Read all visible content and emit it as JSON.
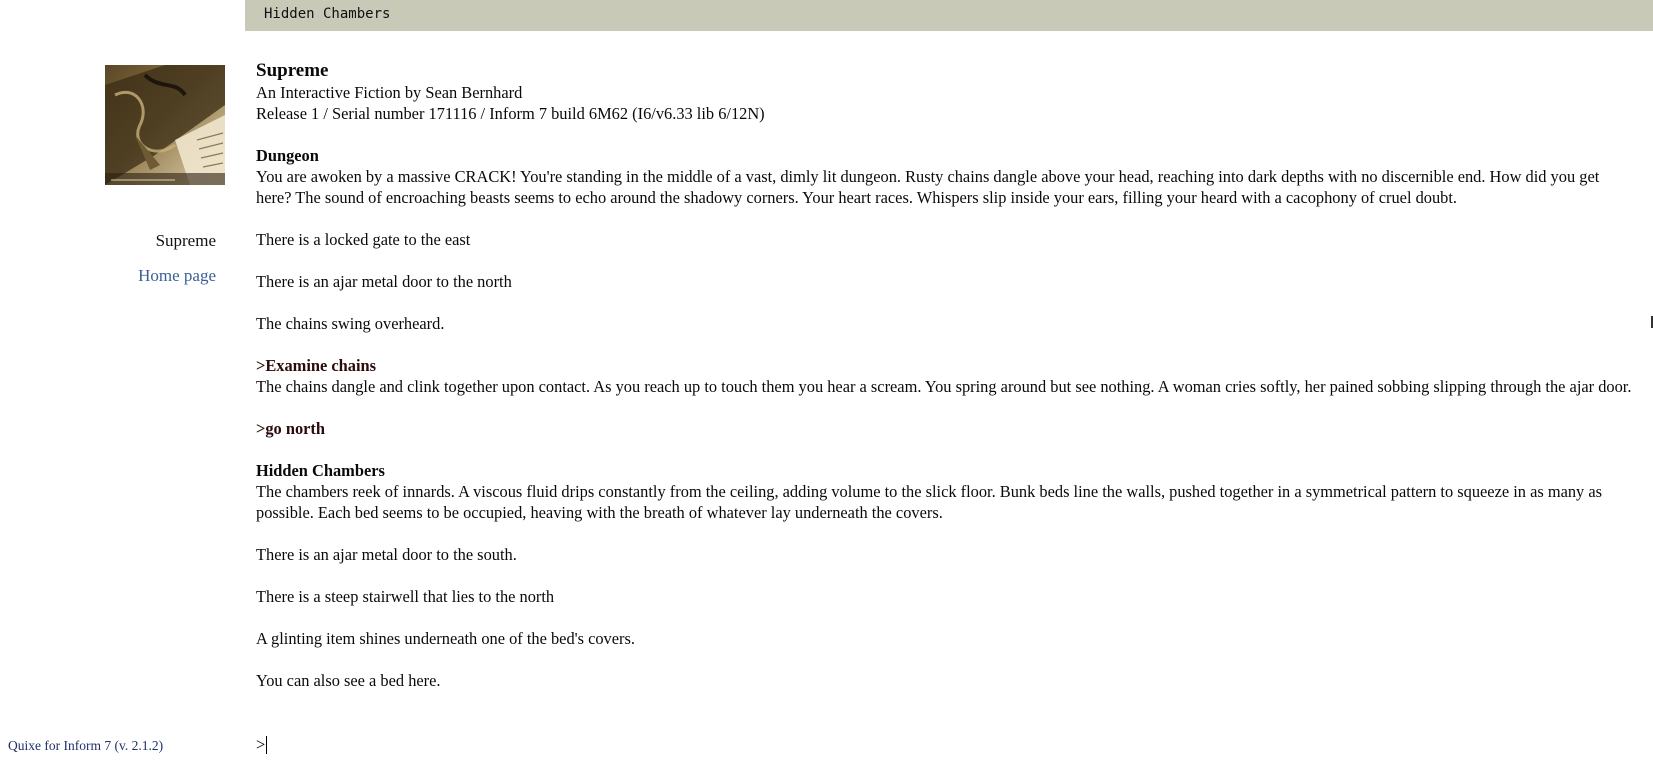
{
  "status_bar": {
    "location": "Hidden Chambers"
  },
  "sidebar": {
    "cover_art_icon": "cover-art-image",
    "story_title": "Supreme",
    "home_link": "Home page",
    "credit_link": "Quixe for Inform 7 (v. 2.1.2)"
  },
  "transcript": {
    "header": {
      "title": "Supreme",
      "byline": "An Interactive Fiction by Sean Bernhard",
      "release": "Release 1 / Serial number 171116 / Inform 7 build 6M62 (I6/v6.33 lib 6/12N)"
    },
    "room1": {
      "name": "Dungeon",
      "description": "You are awoken by a massive CRACK! You're standing in the middle of a vast, dimly lit dungeon. Rusty chains dangle above your head, reaching into dark depths with no discernible end. How did you get here? The sound of encroaching beasts seems to echo around the shadowy corners. Your heart races. Whispers slip inside your ears, filling your heard with a cacophony of cruel doubt.",
      "line1": "There is a locked gate to the east",
      "line2": "There is an ajar metal door to the north",
      "line3": "The chains swing overheard."
    },
    "cmd1": {
      "command": ">Examine chains",
      "response": "The chains dangle and clink together upon contact. As you reach up to touch them you hear a scream. You spring around but see nothing. A woman cries softly, her pained sobbing slipping through the ajar door."
    },
    "cmd2": {
      "command": ">go north"
    },
    "room2": {
      "name": "Hidden Chambers",
      "description": "The chambers reek of innards. A viscous fluid drips constantly from the ceiling, adding volume to the slick floor. Bunk beds line the walls, pushed together in a symmetrical pattern to squeeze in as many as possible. Each bed seems to be occupied, heaving with the breath of whatever lay underneath the covers.",
      "line1": "There is an ajar metal door to the south.",
      "line2": "There is a steep stairwell that lies to the north",
      "line3": "A glinting item shines underneath one of the bed's covers.",
      "line4": "You can also see a bed here."
    },
    "prompt": {
      "symbol": ">",
      "value": ""
    }
  },
  "colors": {
    "status_bar_bg": "#c9c9b8",
    "link": "#3b5e94",
    "credit_link": "#1f2f6a"
  }
}
